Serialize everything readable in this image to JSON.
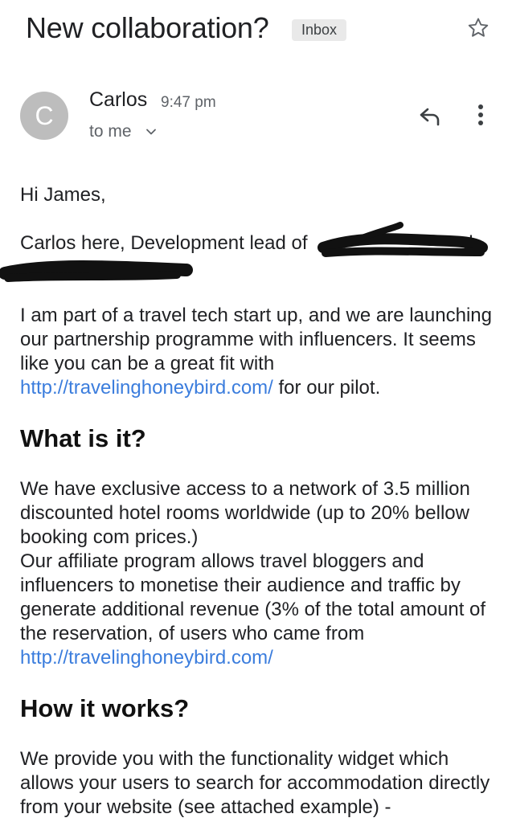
{
  "email": {
    "subject": "New collaboration?",
    "label": "Inbox",
    "sender": {
      "avatar_letter": "C",
      "name": "Carlos",
      "time": "9:47 pm",
      "recipient": "to me"
    }
  },
  "body": {
    "greeting": "Hi James,",
    "intro": "Carlos here, Development lead of",
    "intro_tail": "d",
    "para1": "I am part of a travel tech start up, and we are launching our partnership programme with influencers. It seems like you can be a great fit with",
    "link1": "http://travelinghoneybird.com/",
    "para1_end": "for our pilot.",
    "heading1": "What is it?",
    "para2a": "We have exclusive access to a network of 3.5 million discounted hotel rooms worldwide (up to 20% bellow booking com prices.)",
    "para2b": "Our affiliate program allows travel bloggers and influencers to monetise their audience and traffic by generate additional revenue (3% of the total amount of the reservation, of users who came from",
    "link2": "http://travelinghoneybird.com/",
    "heading2": "How it works?",
    "para3": "We provide you with the functionality widget which allows your users to search for accommodation directly from your website (see attached example) -"
  },
  "icons": {
    "star": "star-outline-icon",
    "reply": "reply-icon",
    "more": "more-vert-icon",
    "expand": "chevron-down-icon"
  },
  "colors": {
    "link": "#3b7ddd",
    "avatar": "#bdbdbd",
    "label_bg": "#e9e9e9",
    "redaction": "#111111"
  }
}
